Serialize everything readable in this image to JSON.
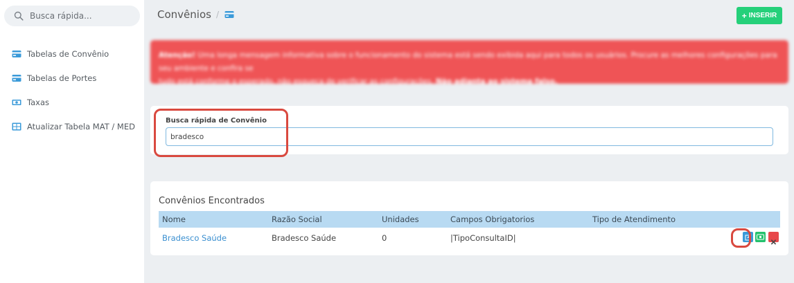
{
  "sidebar": {
    "search_placeholder": "Busca rápida...",
    "items": [
      {
        "label": "Tabelas de Convênio",
        "icon": "card-icon"
      },
      {
        "label": "Tabelas de Portes",
        "icon": "card-icon"
      },
      {
        "label": "Taxas",
        "icon": "money-icon"
      },
      {
        "label": "Atualizar Tabela MAT / MED",
        "icon": "table-icon"
      }
    ]
  },
  "header": {
    "title": "Convênios",
    "separator": "/",
    "insert_label": "INSERIR"
  },
  "alert": {
    "strong": "Atenção!",
    "text": " Uma longa mensagem informativa sobre o funcionamento do sistema está sendo exibida aqui para todos os usuários. Procure as melhores configurações para seu ambiente e confira se",
    "text2": "tudo está conforme o esperado, não esqueça de verificar as configurações. ",
    "strong2": "Não adianta ao sistema falso."
  },
  "search": {
    "label": "Busca rápida de Convênio",
    "value": "bradesco"
  },
  "results": {
    "title": "Convênios Encontrados",
    "columns": [
      "Nome",
      "Razão Social",
      "Unidades",
      "Campos Obrigatorios",
      "Tipo de Atendimento"
    ],
    "rows": [
      {
        "nome": "Bradesco Saúde",
        "razao": "Bradesco Saúde",
        "unidades": "0",
        "campos": "|TipoConsultaID|",
        "tipo": ""
      }
    ]
  },
  "colors": {
    "accent_green": "#25d07a",
    "alert_red": "#ef5456",
    "header_blue": "#b8daf2",
    "link_blue": "#3a8fd0",
    "edit_blue": "#3a9ad9",
    "delete_red": "#e8484b",
    "highlight": "#d9493f"
  }
}
